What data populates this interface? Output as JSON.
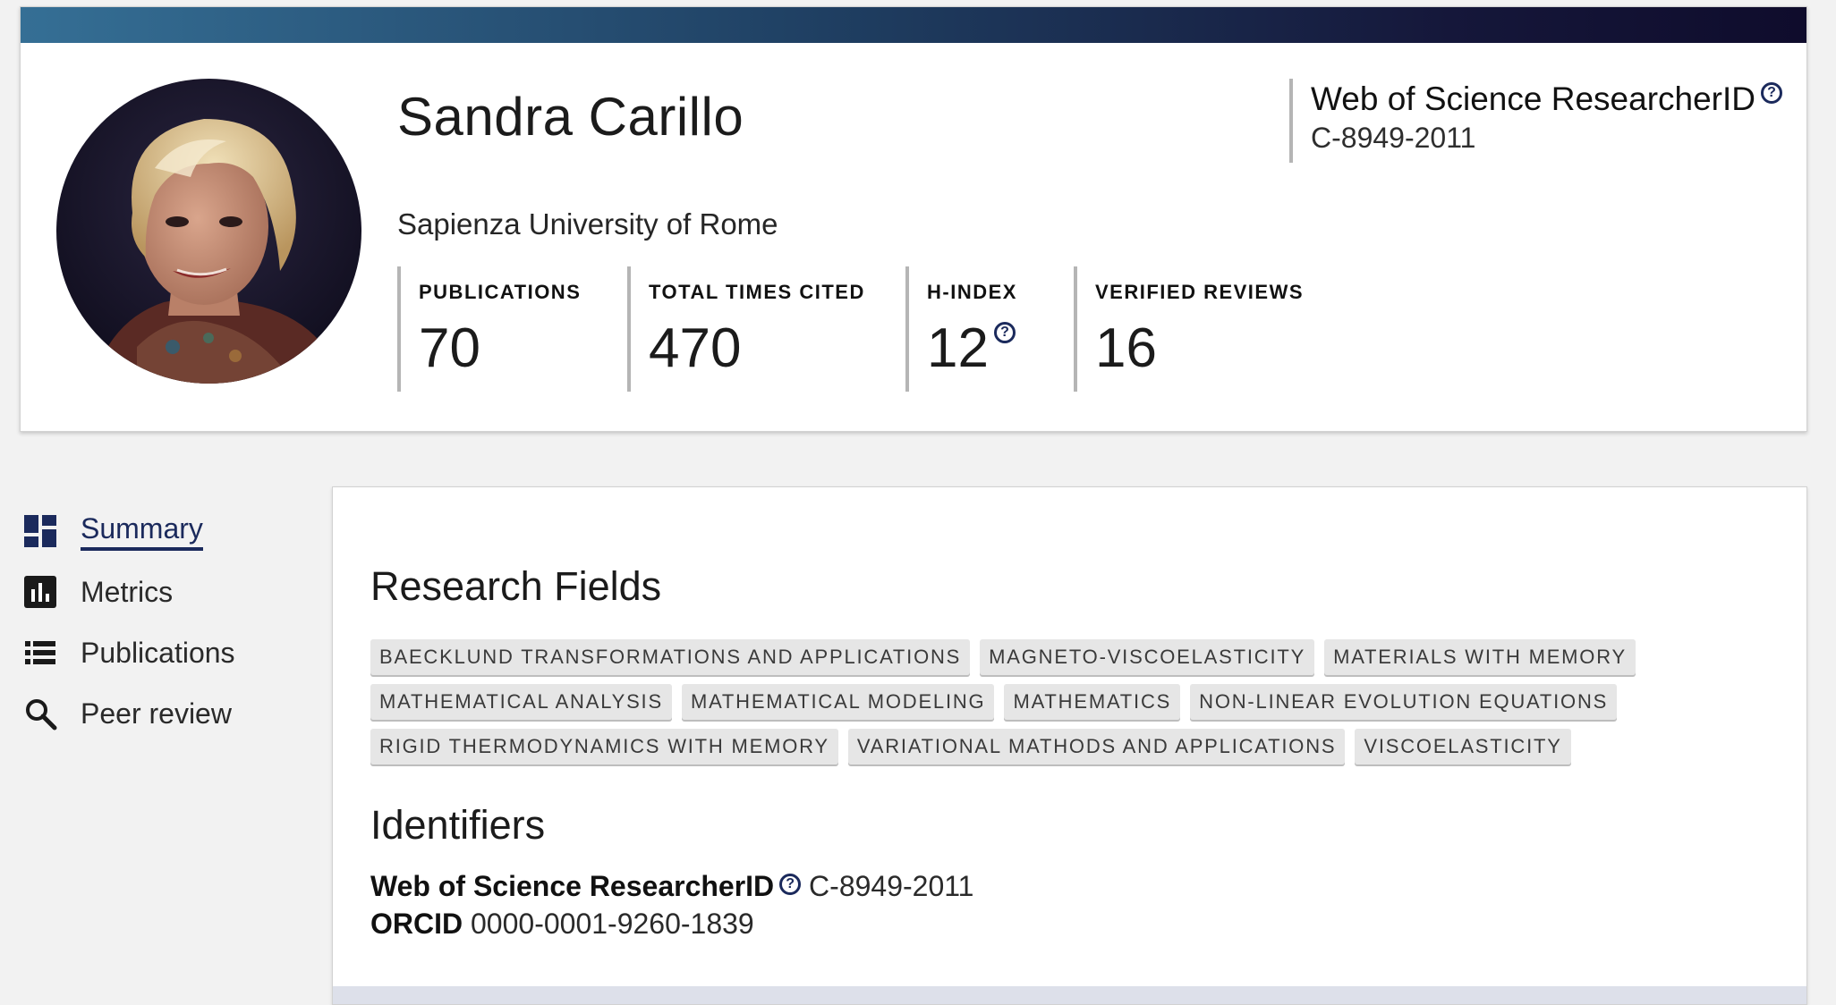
{
  "profile": {
    "name": "Sandra Carillo",
    "affiliation": "Sapienza University of Rome",
    "researcher_id_title": "Web of Science ResearcherID",
    "researcher_id_value": "C-8949-2011",
    "help_glyph": "?"
  },
  "metrics": [
    {
      "label": "PUBLICATIONS",
      "value": "70"
    },
    {
      "label": "TOTAL TIMES CITED",
      "value": "470"
    },
    {
      "label": "H-INDEX",
      "value": "12"
    },
    {
      "label": "VERIFIED REVIEWS",
      "value": "16"
    }
  ],
  "nav": {
    "items": [
      {
        "label": "Summary",
        "icon": "dashboard-icon",
        "active": true
      },
      {
        "label": "Metrics",
        "icon": "bar-chart-icon"
      },
      {
        "label": "Publications",
        "icon": "list-icon"
      },
      {
        "label": "Peer review",
        "icon": "search-icon"
      }
    ]
  },
  "research_fields": {
    "title": "Research Fields",
    "chips": [
      "BAECKLUND TRANSFORMATIONS AND APPLICATIONS",
      "MAGNETO-VISCOELASTICITY",
      "MATERIALS WITH MEMORY",
      "MATHEMATICAL ANALYSIS",
      "MATHEMATICAL MODELING",
      "MATHEMATICS",
      "NON-LINEAR EVOLUTION EQUATIONS",
      "RIGID THERMODYNAMICS WITH MEMORY",
      "VARIATIONAL MATHODS AND APPLICATIONS",
      "VISCOELASTICITY"
    ]
  },
  "identifiers": {
    "title": "Identifiers",
    "wos_label": "Web of Science ResearcherID",
    "wos_value": "C-8949-2011",
    "orcid_label": "ORCID",
    "orcid_value": "0000-0001-9260-1839"
  },
  "colors": {
    "accent": "#1b2a5c",
    "chip_bg": "#e6e6e6",
    "gradient_start": "#356f95",
    "gradient_end": "#0f0c2c"
  }
}
